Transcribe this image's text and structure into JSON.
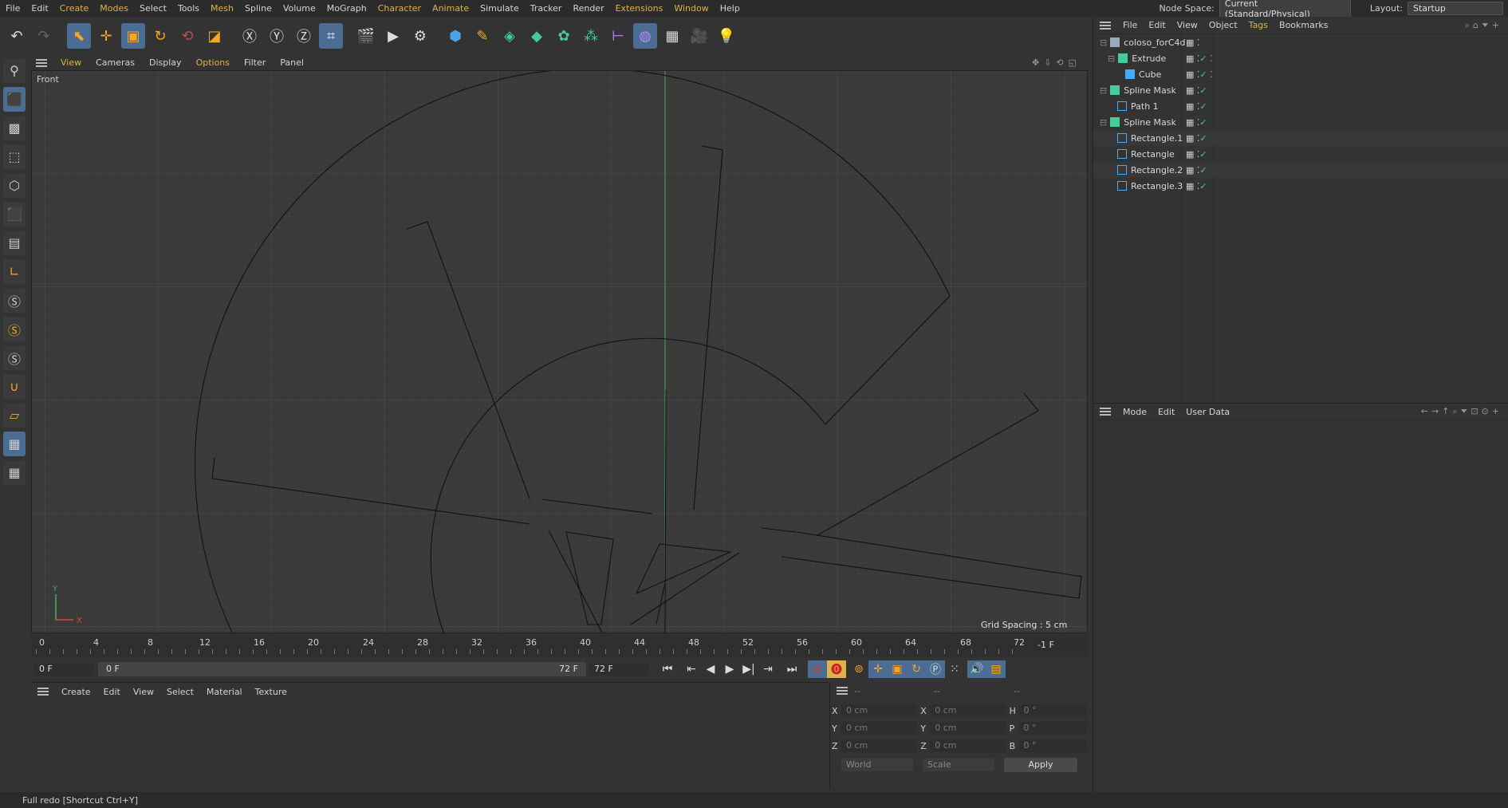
{
  "menubar": {
    "items": [
      "File",
      "Edit",
      "Create",
      "Modes",
      "Select",
      "Tools",
      "Mesh",
      "Spline",
      "Volume",
      "MoGraph",
      "Character",
      "Animate",
      "Simulate",
      "Tracker",
      "Render",
      "Extensions",
      "Window",
      "Help"
    ]
  },
  "topbar": {
    "node_space_label": "Node Space:",
    "node_space_value": "Current (Standard/Physical)",
    "layout_label": "Layout:",
    "layout_value": "Startup"
  },
  "viewport": {
    "menu": [
      "View",
      "Cameras",
      "Display",
      "Options",
      "Filter",
      "Panel"
    ],
    "camera_label": "Front",
    "grid_spacing": "Grid Spacing : 5 cm",
    "axis_y": "Y",
    "axis_x": "X"
  },
  "timeline": {
    "ticks": [
      "0",
      "4",
      "8",
      "12",
      "16",
      "20",
      "24",
      "28",
      "32",
      "36",
      "40",
      "44",
      "48",
      "52",
      "56",
      "60",
      "64",
      "68",
      "72"
    ],
    "current_frame_display": "-1 F",
    "start_field": "0 F",
    "range_start": "0 F",
    "range_end": "72 F",
    "end_field": "72 F"
  },
  "material_panel": {
    "menu": [
      "Create",
      "Edit",
      "View",
      "Select",
      "Material",
      "Texture"
    ]
  },
  "coords": {
    "headers": [
      "--",
      "--",
      "--"
    ],
    "rows": [
      {
        "a": "X",
        "av": "0 cm",
        "b": "X",
        "bv": "0 cm",
        "c": "H",
        "cv": "0 °"
      },
      {
        "a": "Y",
        "av": "0 cm",
        "b": "Y",
        "bv": "0 cm",
        "c": "P",
        "cv": "0 °"
      },
      {
        "a": "Z",
        "av": "0 cm",
        "b": "Z",
        "bv": "0 cm",
        "c": "B",
        "cv": "0 °"
      }
    ],
    "world": "World",
    "scale": "Scale",
    "apply": "Apply"
  },
  "object_manager": {
    "menu": [
      "File",
      "Edit",
      "View",
      "Object",
      "Tags",
      "Bookmarks"
    ],
    "objects": [
      {
        "name": "coloso_forC4d",
        "indent": 0,
        "icon_color": "#9ab"
      },
      {
        "name": "Extrude",
        "indent": 1,
        "icon_color": "#4c9"
      },
      {
        "name": "Cube",
        "indent": 2,
        "icon_color": "#4af"
      },
      {
        "name": "Spline Mask",
        "indent": 0,
        "icon_color": "#4c9"
      },
      {
        "name": "Path 1",
        "indent": 1,
        "icon_color": "#4af"
      },
      {
        "name": "Spline Mask",
        "indent": 0,
        "icon_color": "#4c9"
      },
      {
        "name": "Rectangle.1",
        "indent": 1,
        "icon_color": "#4af"
      },
      {
        "name": "Rectangle",
        "indent": 1,
        "icon_color": "#4af"
      },
      {
        "name": "Rectangle.2",
        "indent": 1,
        "icon_color": "#4af"
      },
      {
        "name": "Rectangle.3",
        "indent": 1,
        "icon_color": "#4af"
      }
    ]
  },
  "attribute_manager": {
    "menu": [
      "Mode",
      "Edit",
      "User Data"
    ]
  },
  "status": "Full redo [Shortcut Ctrl+Y]",
  "colors": {
    "accent": "#4b6d94",
    "y_axis": "#3fae5a",
    "menu_hl": "#e0b24a"
  }
}
